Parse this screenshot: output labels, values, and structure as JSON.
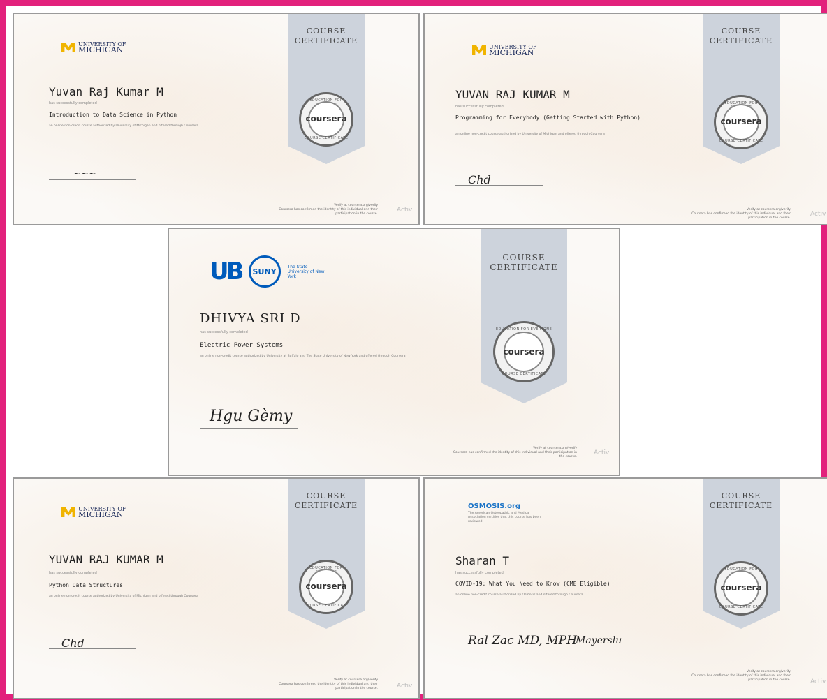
{
  "ribbon": {
    "line1": "COURSE",
    "line2": "CERTIFICATE"
  },
  "seal": {
    "word": "coursera",
    "top": "EDUCATION FOR EVERYONE",
    "bottom": "COURSE CERTIFICATE"
  },
  "watermark": "Activ",
  "certificates": [
    {
      "id": "cert1",
      "logo": {
        "line1": "UNIVERSITY OF",
        "line2": "MICHIGAN"
      },
      "name": "Yuvan Raj Kumar M",
      "completed": "has successfully completed",
      "course": "Introduction to Data Science in Python",
      "desc": "an online non-credit course authorized by University of Michigan and offered through Coursera"
    },
    {
      "id": "cert2",
      "logo": {
        "line1": "UNIVERSITY OF",
        "line2": "MICHIGAN"
      },
      "name": "YUVAN RAJ KUMAR M",
      "completed": "has successfully completed",
      "course": "Programming for Everybody (Getting Started with Python)",
      "desc": "an online non-credit course authorized by University of Michigan and offered through Coursera"
    },
    {
      "id": "cert3",
      "logo": {
        "suny": "SUNY",
        "suny_text": "The State University of New York"
      },
      "name": "DHIVYA SRI D",
      "completed": "has successfully completed",
      "course": "Electric Power Systems",
      "desc": "an online non-credit course authorized by University at Buffalo and The State University of New York and offered through Coursera"
    },
    {
      "id": "cert4",
      "logo": {
        "line1": "UNIVERSITY OF",
        "line2": "MICHIGAN"
      },
      "name": "YUVAN RAJ KUMAR M",
      "completed": "has successfully completed",
      "course": "Python Data Structures",
      "desc": "an online non-credit course authorized by University of Michigan and offered through Coursera"
    },
    {
      "id": "cert5",
      "logo": {
        "text": "OSMOSIS.org"
      },
      "name": "Sharan T",
      "completed": "has successfully completed",
      "course": "COVID-19: What You Need to Know (CME Eligible)",
      "desc": "an online non-credit course authorized by Osmosis and offered through Coursera"
    }
  ]
}
